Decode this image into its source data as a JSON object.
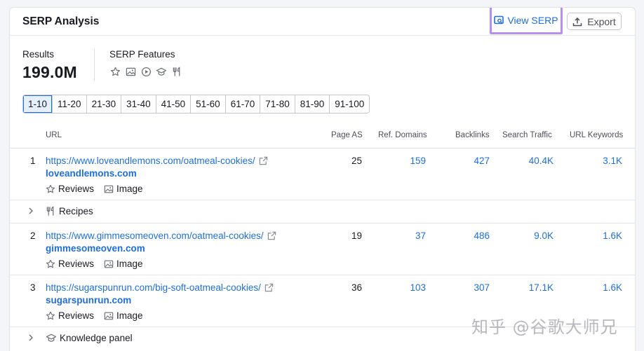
{
  "header": {
    "title": "SERP Analysis",
    "view_serp_label": "View SERP",
    "export_label": "Export"
  },
  "summary": {
    "results_label": "Results",
    "results_value": "199.0M",
    "features_label": "SERP Features",
    "feature_icons": [
      "star-icon",
      "image-icon",
      "video-icon",
      "graduation-cap-icon",
      "fork-knife-icon"
    ]
  },
  "pagination": {
    "pages": [
      "1-10",
      "11-20",
      "21-30",
      "31-40",
      "41-50",
      "51-60",
      "61-70",
      "71-80",
      "81-90",
      "91-100"
    ],
    "active": "1-10"
  },
  "table": {
    "columns": {
      "url": "URL",
      "page_as": "Page AS",
      "ref_domains": "Ref. Domains",
      "backlinks": "Backlinks",
      "search_traffic": "Search Traffic",
      "url_keywords": "URL Keywords"
    },
    "rows": [
      {
        "rank": "1",
        "url": "https://www.loveandlemons.com/oatmeal-cookies/",
        "domain": "loveandlemons.com",
        "tags": [
          "Reviews",
          "Image"
        ],
        "page_as": "25",
        "ref_domains": "159",
        "backlinks": "427",
        "search_traffic": "40.4K",
        "url_keywords": "3.1K"
      },
      {
        "rank": "2",
        "url": "https://www.gimmesomeoven.com/oatmeal-cookies/",
        "domain": "gimmesomeoven.com",
        "tags": [
          "Reviews",
          "Image"
        ],
        "page_as": "19",
        "ref_domains": "37",
        "backlinks": "486",
        "search_traffic": "9.0K",
        "url_keywords": "1.6K"
      },
      {
        "rank": "3",
        "url": "https://sugarspunrun.com/big-soft-oatmeal-cookies/",
        "domain": "sugarspunrun.com",
        "tags": [
          "Reviews",
          "Image"
        ],
        "page_as": "36",
        "ref_domains": "103",
        "backlinks": "307",
        "search_traffic": "17.1K",
        "url_keywords": "1.6K"
      }
    ],
    "feature_rows": [
      {
        "label": "Recipes",
        "icon": "fork-knife-icon"
      },
      {
        "label": "Knowledge panel",
        "icon": "graduation-cap-icon"
      }
    ]
  },
  "watermark": "知乎 @谷歌大师兄",
  "colors": {
    "link": "#1e6fdc",
    "highlight_border": "#b68ff0",
    "active_page_bg": "#e6f0fc"
  }
}
